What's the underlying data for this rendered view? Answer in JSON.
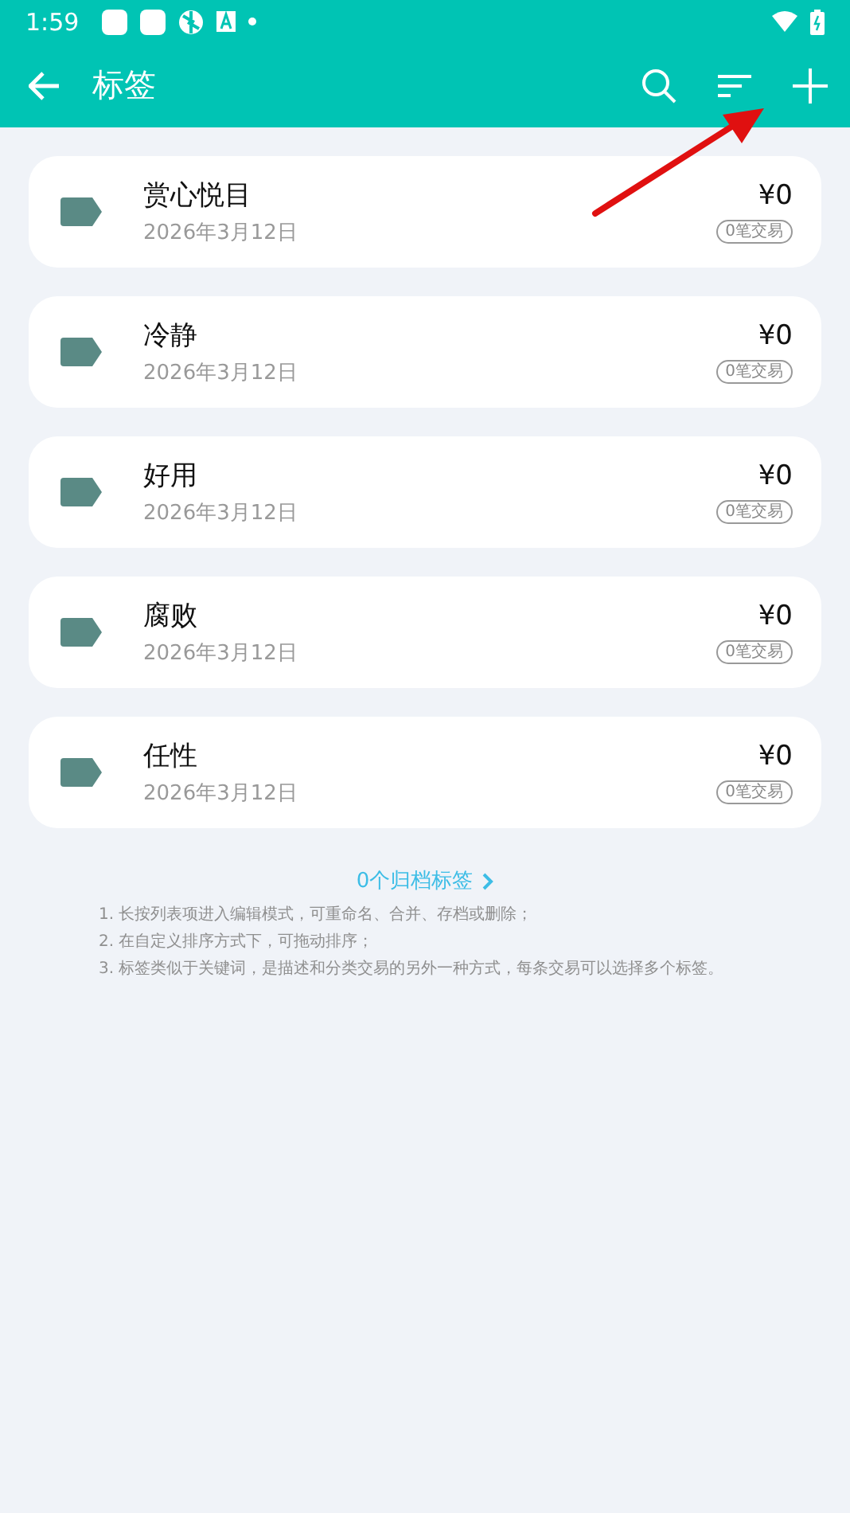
{
  "status_bar": {
    "time": "1:59"
  },
  "app_bar": {
    "title": "标签"
  },
  "tags": [
    {
      "name": "赏心悦目",
      "date": "2026年3月12日",
      "amount": "¥0",
      "count": "0笔交易"
    },
    {
      "name": "冷静",
      "date": "2026年3月12日",
      "amount": "¥0",
      "count": "0笔交易"
    },
    {
      "name": "好用",
      "date": "2026年3月12日",
      "amount": "¥0",
      "count": "0笔交易"
    },
    {
      "name": "腐败",
      "date": "2026年3月12日",
      "amount": "¥0",
      "count": "0笔交易"
    },
    {
      "name": "任性",
      "date": "2026年3月12日",
      "amount": "¥0",
      "count": "0笔交易"
    }
  ],
  "archived_link": "0个归档标签",
  "notes": [
    "1. 长按列表项进入编辑模式，可重命名、合并、存档或删除；",
    "2. 在自定义排序方式下，可拖动排序；",
    "3. 标签类似于关键词，是描述和分类交易的另外一种方式，每条交易可以选择多个标签。"
  ]
}
